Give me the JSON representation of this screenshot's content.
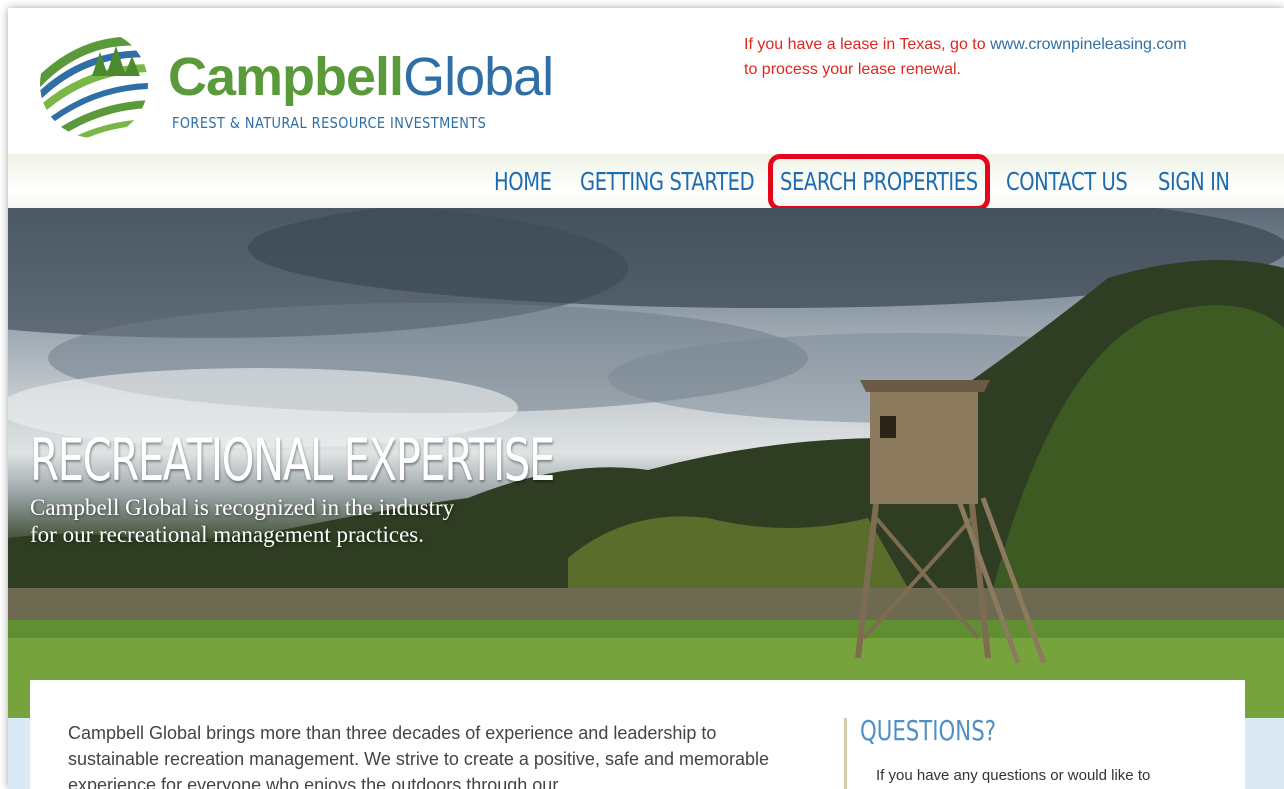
{
  "header": {
    "brand_bold": "Campbell",
    "brand_light": "Global",
    "tagline": "FOREST & NATURAL RESOURCE INVESTMENTS",
    "notice_pre": "If you have a lease in Texas, go to ",
    "notice_link": "www.crownpineleasing.com",
    "notice_post": "to process your lease renewal."
  },
  "nav": {
    "items": [
      "HOME",
      "GETTING STARTED",
      "SEARCH PROPERTIES",
      "CONTACT US",
      "SIGN IN"
    ]
  },
  "hero": {
    "title": "RECREATIONAL EXPERTISE",
    "subtitle_line1": "Campbell Global is recognized in the industry",
    "subtitle_line2": "for our recreational management practices."
  },
  "content": {
    "intro": "Campbell Global brings more than three decades of experience and leadership to sustainable recreation management. We strive to create a positive, safe and memorable experience for everyone who enjoys the outdoors through our",
    "aside_title": "QUESTIONS?",
    "aside_text": "If you have any questions or would like to"
  },
  "colors": {
    "brand_green": "#5a9a3a",
    "brand_blue": "#2f6fa6",
    "nav_blue": "#1f6bb0",
    "notice_red": "#e0261c",
    "highlight_red": "#e5061b"
  }
}
